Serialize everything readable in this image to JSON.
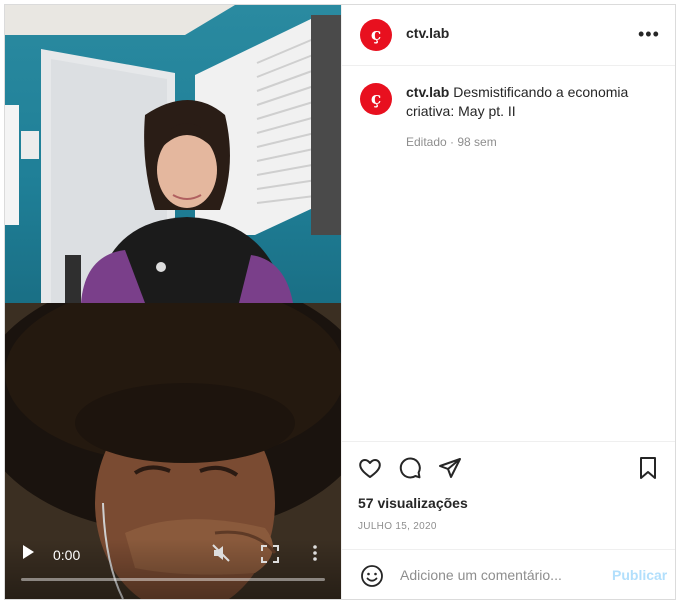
{
  "post": {
    "username": "ctv.lab",
    "avatar_glyph": "ç",
    "caption_text": "Desmistificando a economia criativa: May pt. II",
    "meta": "Editado · 98 sem",
    "views": "57 visualizações",
    "date": "JULHO 15, 2020"
  },
  "video": {
    "time": "0:00",
    "progress": 0
  },
  "comment": {
    "placeholder": "Adicione um comentário...",
    "publish_label": "Publicar"
  },
  "colors": {
    "brand": "#e8101f",
    "publish_disabled": "#b2dffc",
    "muted_text": "#8e8e8e"
  },
  "icons": [
    "heart-icon",
    "comment-icon",
    "share-icon",
    "bookmark-icon",
    "emoji-icon",
    "more-icon",
    "play-icon",
    "mute-icon",
    "fullscreen-icon"
  ]
}
